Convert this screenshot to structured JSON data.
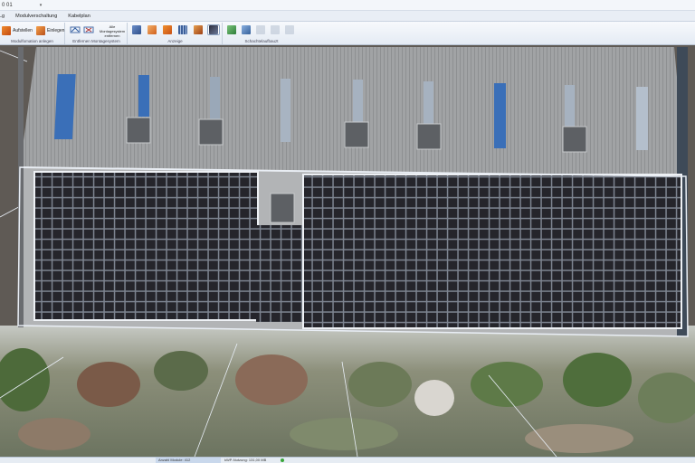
{
  "titlebar": {
    "fragment": "0 01"
  },
  "tabs": [
    {
      "label": "Lg"
    },
    {
      "label": "Modulverschaltung"
    },
    {
      "label": "Kabelplan"
    }
  ],
  "ribbon": {
    "group1": {
      "label": "Modulfomation anlegen",
      "aufstellen": "Aufstellen",
      "einlegen": "Einlegen"
    },
    "group2": {
      "label": "Entfernen Montagesystem",
      "action": "Alle Montagesystem entfernen"
    },
    "group3": {
      "label": "Anzeige"
    },
    "group4": {
      "label": "Schachtelaufbauzt"
    }
  },
  "status": {
    "modules_label": "Anzahl Module: 412",
    "power_label": "kWP-Nutzung: 131,00 MB"
  },
  "colors": {
    "panel": "#25252b",
    "roof": "#9a9c9f",
    "accent": "#2c5aa0"
  }
}
